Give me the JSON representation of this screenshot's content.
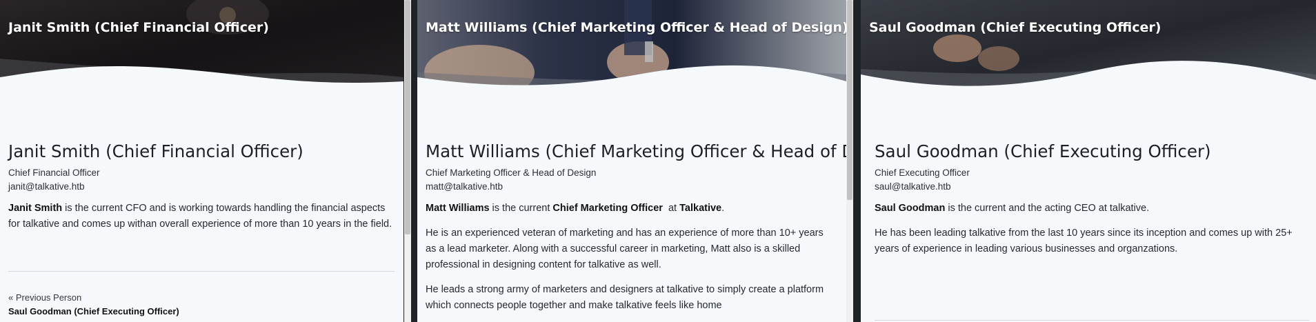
{
  "panels": [
    {
      "hero_title": "Janit Smith (Chief Financial Officer)",
      "name": "Janit Smith (Chief Financial Officer)",
      "role": "Chief Financial Officer",
      "email": "janit@talkative.htb",
      "p1_bold": "Janit Smith",
      "p1_rest": " is the current CFO and is working towards handling the financial aspects for talkative and comes up withan overall experience of more than 10 years in the field.",
      "nav": {
        "label": "« Previous Person",
        "name": "Saul Goodman (Chief Executing Officer)"
      }
    },
    {
      "hero_title": "Matt Williams (Chief Marketing Officer & Head of Design)",
      "name": "Matt Williams (Chief Marketing Officer & Head of Design)",
      "role": "Chief Marketing Officer & Head of Design",
      "email": "matt@talkative.htb",
      "p1_bold1": "Matt Williams",
      "p1_mid1": " is the current ",
      "p1_bold2": "Chief Marketing Officer",
      "p1_mid2": "  at ",
      "p1_bold3": "Talkative",
      "p1_end": ".",
      "p2": "He is an experienced veteran of marketing and has an experience of more than 10+ years as a lead marketer. Along with a successful career in marketing, Matt also is a skilled professional in designing content for talkative as well.",
      "p3": "He leads a strong army of marketers and designers at talkative to simply create a platform which connects people together and make talkative feels like home"
    },
    {
      "hero_title": "Saul Goodman (Chief Executing Officer)",
      "name": "Saul Goodman (Chief Executing Officer)",
      "role": "Chief Executing Officer",
      "email": "saul@talkative.htb",
      "p1_bold": "Saul Goodman",
      "p1_rest": " is the current and the acting CEO at talkative.",
      "p2": "He has been leading talkative from the last 10 years since its inception and comes up with 25+ years of experience in leading various businesses and organzations."
    }
  ],
  "icons": {
    "hero1": "suit-photo",
    "hero2": "suit-photo",
    "hero3": "suit-photo"
  }
}
